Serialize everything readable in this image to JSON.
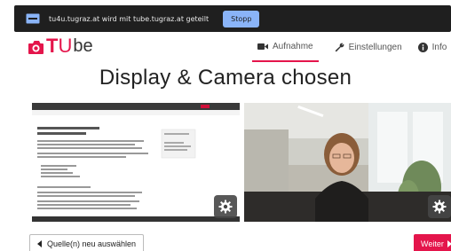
{
  "share_bar": {
    "text": "tu4u.tugraz.at wird mit tube.tugraz.at geteilt",
    "stop_label": "Stopp"
  },
  "brand": {
    "logo_prefix_t": "T",
    "logo_prefix_u": "U",
    "logo_suffix": "be",
    "accent": "#e4154b"
  },
  "nav": {
    "items": [
      {
        "label": "Aufnahme",
        "icon": "video-camera-icon",
        "active": true
      },
      {
        "label": "Einstellungen",
        "icon": "wrench-icon",
        "active": false
      },
      {
        "label": "Info",
        "icon": "info-icon",
        "active": false
      }
    ]
  },
  "main": {
    "title": "Display & Camera chosen"
  },
  "footer": {
    "back_label": "Quelle(n) neu auswählen",
    "next_label": "Weiter"
  }
}
